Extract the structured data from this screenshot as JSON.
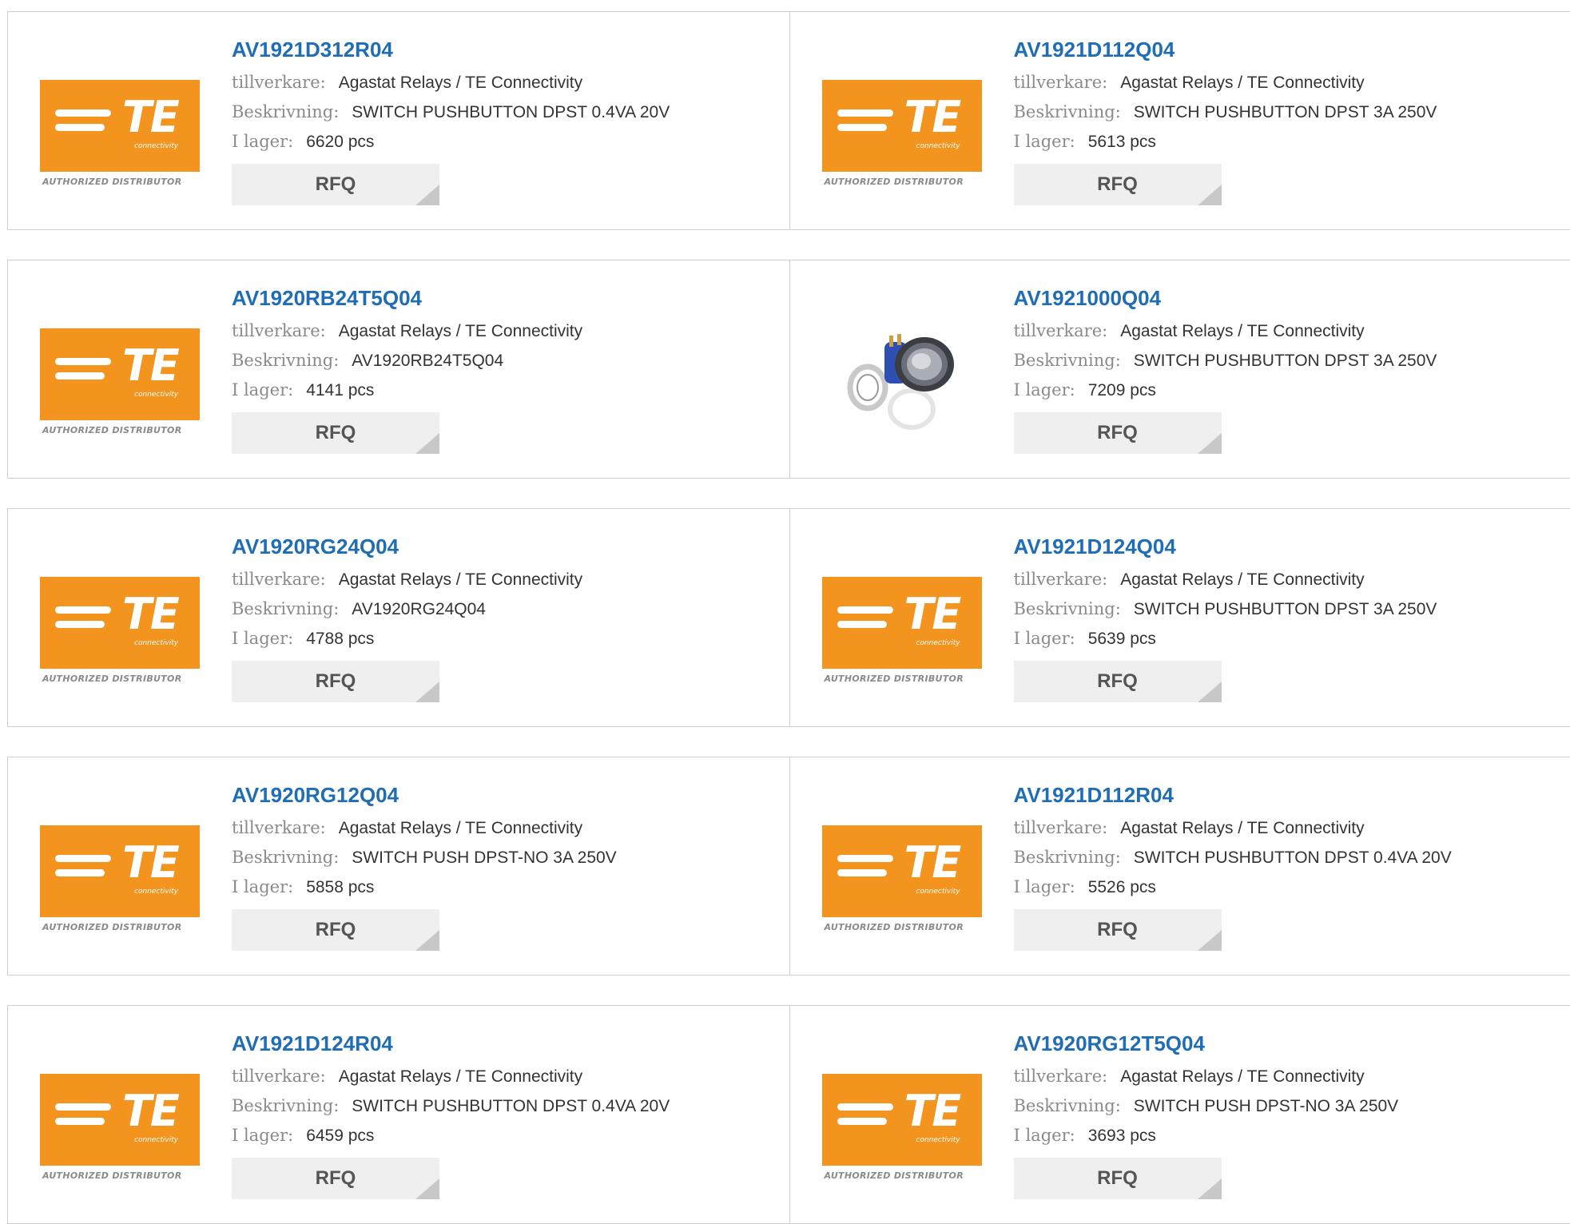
{
  "labels": {
    "manufacturer": "tillverkare:",
    "description": "Beskrivning:",
    "stock": "I lager:",
    "rfq": "RFQ"
  },
  "logo": {
    "brand": "TE",
    "sub": "connectivity",
    "footer": "AUTHORIZED DISTRIBUTOR",
    "color": "#f3941f"
  },
  "colors": {
    "link": "#1f6db5",
    "button_bg": "#efefef"
  },
  "products": [
    {
      "part": "AV1921D312R04",
      "manufacturer": "Agastat Relays / TE Connectivity",
      "description": "SWITCH PUSHBUTTON DPST 0.4VA 20V",
      "stock": "6620 pcs",
      "image": "te-logo"
    },
    {
      "part": "AV1921D112Q04",
      "manufacturer": "Agastat Relays / TE Connectivity",
      "description": "SWITCH PUSHBUTTON DPST 3A 250V",
      "stock": "5613 pcs",
      "image": "te-logo"
    },
    {
      "part": "AV1920RB24T5Q04",
      "manufacturer": "Agastat Relays / TE Connectivity",
      "description": "AV1920RB24T5Q04",
      "stock": "4141 pcs",
      "image": "te-logo"
    },
    {
      "part": "AV1921000Q04",
      "manufacturer": "Agastat Relays / TE Connectivity",
      "description": "SWITCH PUSHBUTTON DPST 3A 250V",
      "stock": "7209 pcs",
      "image": "pushbutton-photo"
    },
    {
      "part": "AV1920RG24Q04",
      "manufacturer": "Agastat Relays / TE Connectivity",
      "description": "AV1920RG24Q04",
      "stock": "4788 pcs",
      "image": "te-logo"
    },
    {
      "part": "AV1921D124Q04",
      "manufacturer": "Agastat Relays / TE Connectivity",
      "description": "SWITCH PUSHBUTTON DPST 3A 250V",
      "stock": "5639 pcs",
      "image": "te-logo"
    },
    {
      "part": "AV1920RG12Q04",
      "manufacturer": "Agastat Relays / TE Connectivity",
      "description": "SWITCH PUSH DPST-NO 3A 250V",
      "stock": "5858 pcs",
      "image": "te-logo"
    },
    {
      "part": "AV1921D112R04",
      "manufacturer": "Agastat Relays / TE Connectivity",
      "description": "SWITCH PUSHBUTTON DPST 0.4VA 20V",
      "stock": "5526 pcs",
      "image": "te-logo"
    },
    {
      "part": "AV1921D124R04",
      "manufacturer": "Agastat Relays / TE Connectivity",
      "description": "SWITCH PUSHBUTTON DPST 0.4VA 20V",
      "stock": "6459 pcs",
      "image": "te-logo"
    },
    {
      "part": "AV1920RG12T5Q04",
      "manufacturer": "Agastat Relays / TE Connectivity",
      "description": "SWITCH PUSH DPST-NO 3A 250V",
      "stock": "3693 pcs",
      "image": "te-logo"
    }
  ]
}
